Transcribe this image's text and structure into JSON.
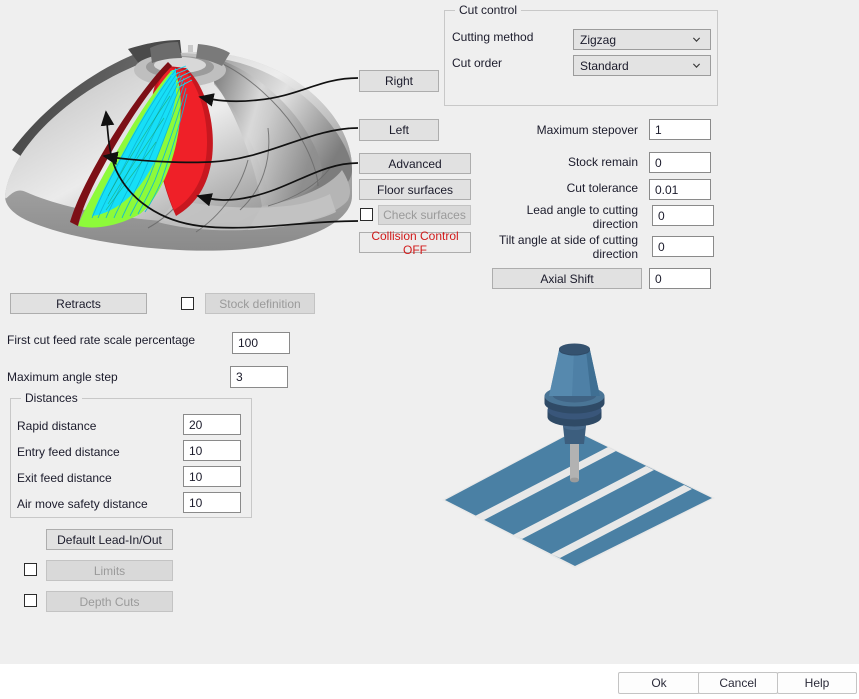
{
  "dialog": {
    "background_color": "#efefef",
    "footer_background": "#ffffff"
  },
  "graphics": {
    "impeller": {
      "name": "impeller-blade-toolpath-illustration",
      "colors": {
        "body_light": "#d4d4d4",
        "body_mid": "#9a9a9a",
        "body_dark": "#5a5a5a",
        "toolpath_cyan": "#00d7f5",
        "toolpath_green": "#7cf53a",
        "toolpath_red": "#e8121b",
        "leader_line": "#111111"
      },
      "leader_lines": 4
    },
    "tool_stock": {
      "name": "tool-holder-over-stock-illustration",
      "colors": {
        "tool_light": "#4e80a6",
        "tool_dark": "#2f4a66",
        "plate": "#4a80a4",
        "pass_line": "#e8e8e8",
        "shank": "#b0b0b0"
      },
      "pass_count": 3
    }
  },
  "side_buttons": {
    "right": "Right",
    "left": "Left",
    "advanced": "Advanced",
    "floor_surfaces": "Floor surfaces",
    "check_surfaces": "Check surfaces",
    "check_surfaces_enabled": false,
    "check_surfaces_checked": false,
    "collision_control": "Collision Control OFF",
    "collision_control_color": "#d11a1a"
  },
  "cut_control": {
    "title": "Cut control",
    "rows": [
      {
        "label": "Cutting method",
        "value": "Zigzag"
      },
      {
        "label": "Cut order",
        "value": "Standard"
      }
    ]
  },
  "parameters": [
    {
      "label": "Maximum stepover",
      "value": "1"
    },
    {
      "label": "Stock remain",
      "value": "0"
    },
    {
      "label": "Cut tolerance",
      "value": "0.01"
    },
    {
      "label": "Lead angle to cutting direction",
      "value": "0"
    },
    {
      "label": "Tilt angle at side of cutting direction",
      "value": "0"
    }
  ],
  "axial_shift": {
    "button_label": "Axial Shift",
    "value": "0"
  },
  "retracts": {
    "button_label": "Retracts",
    "stock_definition_label": "Stock definition",
    "stock_definition_enabled": false,
    "stock_definition_checked": false
  },
  "left_fields": [
    {
      "label": "First cut feed rate scale percentage",
      "value": "100"
    },
    {
      "label": "Maximum angle step",
      "value": "3"
    }
  ],
  "distances": {
    "title": "Distances",
    "rows": [
      {
        "label": "Rapid distance",
        "value": "20"
      },
      {
        "label": "Entry feed distance",
        "value": "10"
      },
      {
        "label": "Exit feed distance",
        "value": "10"
      },
      {
        "label": "Air move safety distance",
        "value": "10"
      }
    ]
  },
  "bottom_left_buttons": [
    {
      "label": "Default Lead-In/Out",
      "enabled": true,
      "has_checkbox": false,
      "checked": false
    },
    {
      "label": "Limits",
      "enabled": false,
      "has_checkbox": true,
      "checked": false
    },
    {
      "label": "Depth Cuts",
      "enabled": false,
      "has_checkbox": true,
      "checked": false
    }
  ],
  "footer": {
    "ok": "Ok",
    "cancel": "Cancel",
    "help": "Help"
  }
}
